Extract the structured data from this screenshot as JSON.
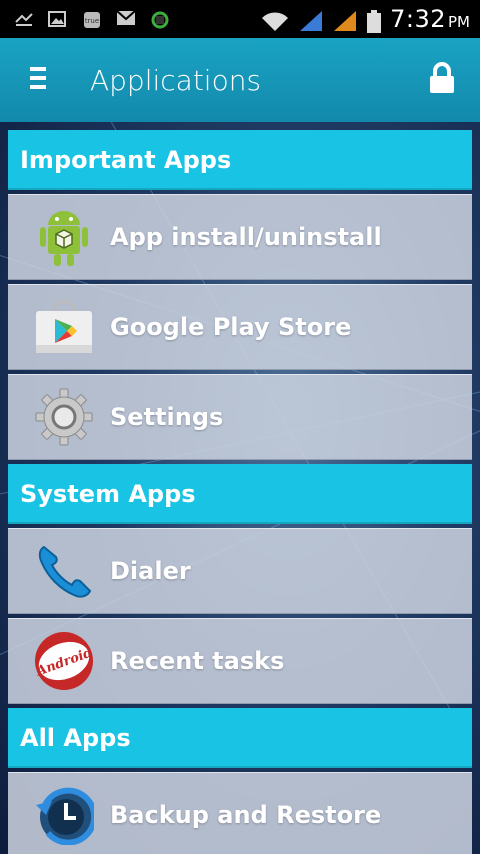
{
  "status_bar": {
    "time": "7:32",
    "ampm": "PM",
    "icons": [
      "missed-call-icon",
      "gallery-icon",
      "notification-icon",
      "gmail-icon",
      "sync-icon",
      "wifi-icon",
      "signal-icon",
      "signal-icon",
      "battery-icon"
    ]
  },
  "app_bar": {
    "title": "Applications",
    "menu_icon": "menu-icon",
    "lock_icon": "lock-icon"
  },
  "sections": {
    "important": {
      "title": "Important Apps",
      "items": [
        {
          "label": "App install/uninstall",
          "icon": "android-robot-icon"
        },
        {
          "label": "Google Play Store",
          "icon": "play-store-icon"
        },
        {
          "label": "Settings",
          "icon": "gear-icon"
        }
      ]
    },
    "system": {
      "title": "System Apps",
      "items": [
        {
          "label": "Dialer",
          "icon": "phone-icon"
        },
        {
          "label": "Recent tasks",
          "icon": "android-badge-icon"
        }
      ]
    },
    "all": {
      "title": "All Apps",
      "items": [
        {
          "label": "Backup and Restore",
          "icon": "backup-clock-icon"
        }
      ]
    }
  },
  "colors": {
    "app_bar": "#1289ab",
    "section_header": "#19c3e3",
    "row_bg": "#cdd4e1"
  }
}
